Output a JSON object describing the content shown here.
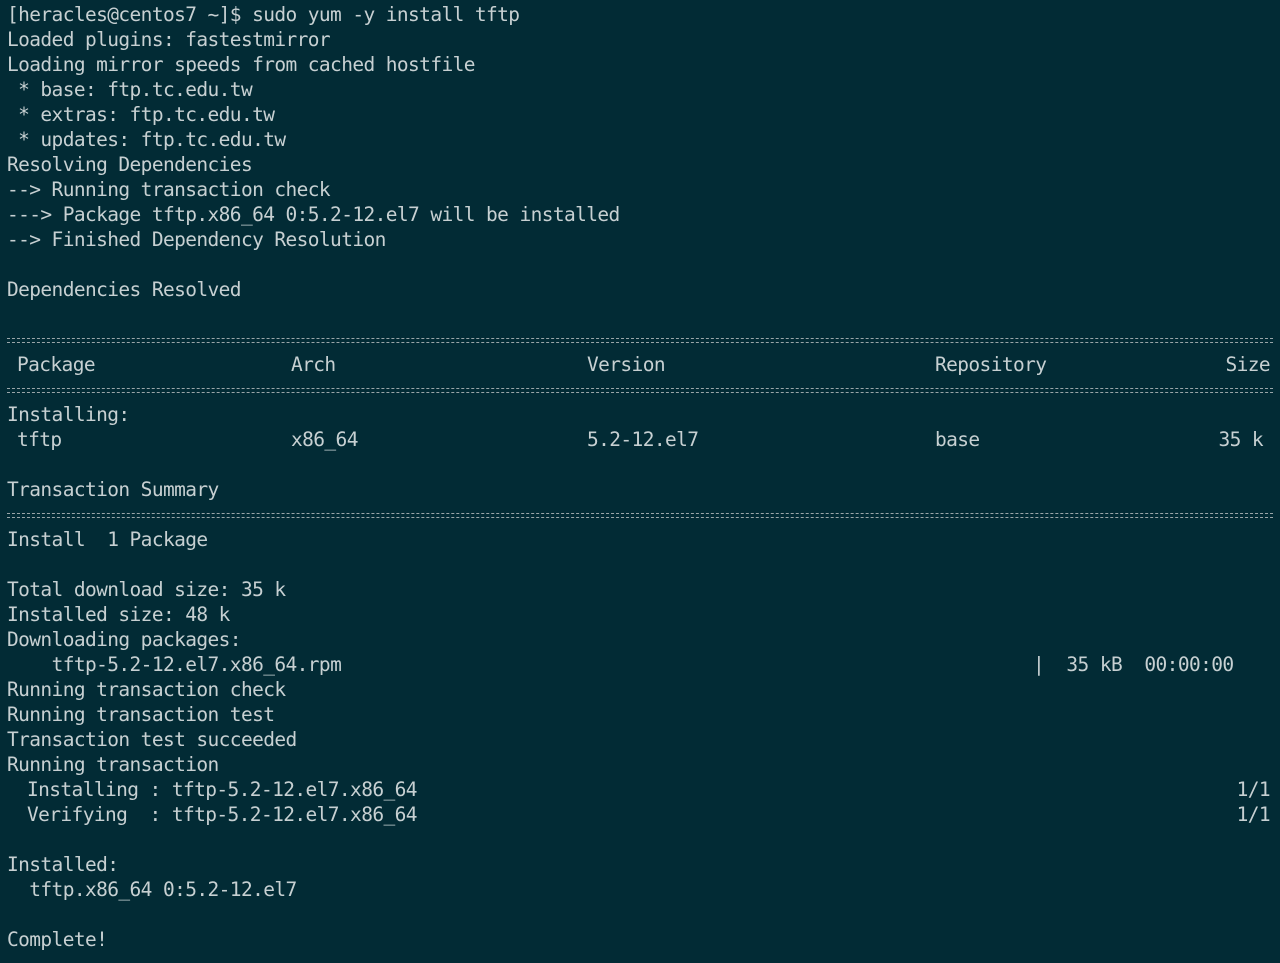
{
  "terminal": {
    "prompt": "[heracles@centos7 ~]$ sudo yum -y install tftp",
    "lines_top": [
      "Loaded plugins: fastestmirror",
      "Loading mirror speeds from cached hostfile",
      " * base: ftp.tc.edu.tw",
      " * extras: ftp.tc.edu.tw",
      " * updates: ftp.tc.edu.tw",
      "Resolving Dependencies",
      "--> Running transaction check",
      "---> Package tftp.x86_64 0:5.2-12.el7 will be installed",
      "--> Finished Dependency Resolution",
      "",
      "Dependencies Resolved"
    ],
    "table": {
      "headers": {
        "package": "Package",
        "arch": "Arch",
        "version": "Version",
        "repository": "Repository",
        "size": "Size"
      },
      "section_label": "Installing:",
      "row": {
        "package": "tftp",
        "arch": "x86_64",
        "version": "5.2-12.el7",
        "repository": "base",
        "size": "35 k"
      }
    },
    "summary_title": "Transaction Summary",
    "install_line": "Install  1 Package",
    "total_download": "Total download size: 35 k",
    "installed_size": "Installed size: 48 k",
    "downloading": "Downloading packages:",
    "download": {
      "file": "tftp-5.2-12.el7.x86_64.rpm",
      "meta": "|  35 kB  00:00:00"
    },
    "run_lines": [
      "Running transaction check",
      "Running transaction test",
      "Transaction test succeeded",
      "Running transaction"
    ],
    "steps": [
      {
        "text": "Installing : tftp-5.2-12.el7.x86_64",
        "count": "1/1"
      },
      {
        "text": "Verifying  : tftp-5.2-12.el7.x86_64",
        "count": "1/1"
      }
    ],
    "installed_label": "Installed:",
    "installed_pkg": "  tftp.x86_64 0:5.2-12.el7",
    "complete": "Complete!"
  }
}
